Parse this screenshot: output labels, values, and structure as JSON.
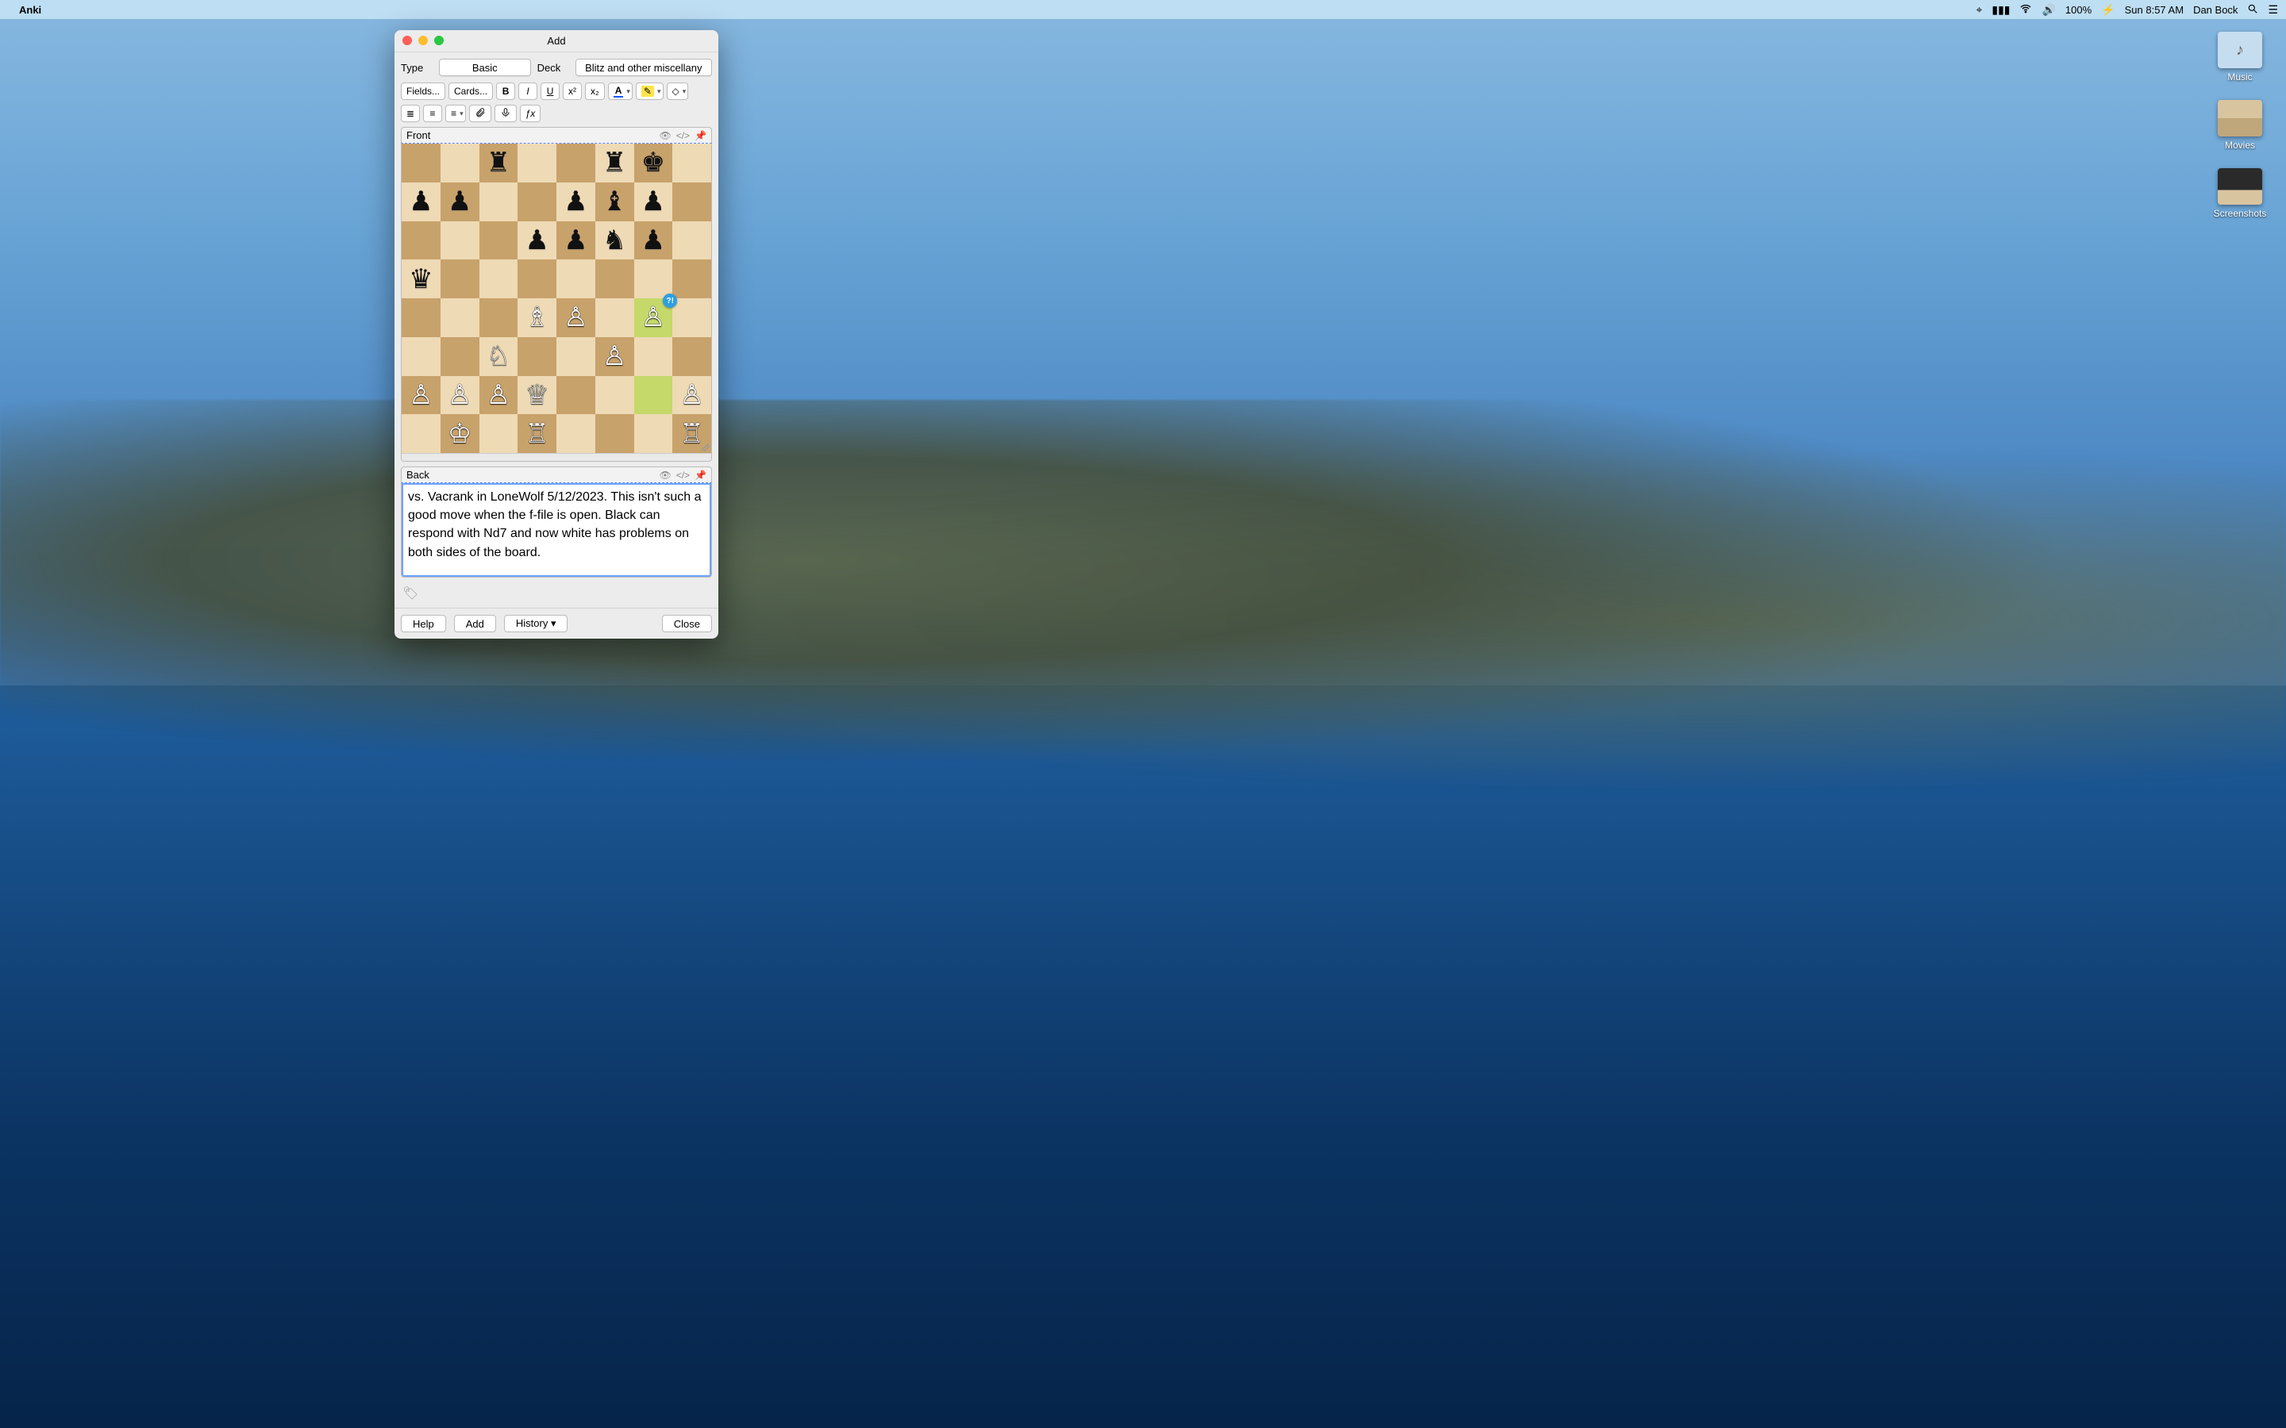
{
  "menubar": {
    "app_name": "Anki",
    "battery": "100%",
    "clock": "Sun 8:57 AM",
    "user": "Dan Bock"
  },
  "desktop": {
    "icons": [
      {
        "label": "Music"
      },
      {
        "label": "Movies"
      },
      {
        "label": "Screenshots"
      }
    ]
  },
  "window": {
    "title": "Add",
    "type_label": "Type",
    "type_value": "Basic",
    "deck_label": "Deck",
    "deck_value": "Blitz and other miscellany",
    "toolbar": {
      "fields": "Fields...",
      "cards": "Cards...",
      "bold": "B",
      "italic": "I",
      "underline": "U",
      "super": "x²",
      "sub": "x₂",
      "text_color": "A",
      "highlight": "✎",
      "eraser": "⌫",
      "ul": "•",
      "ol": "1.",
      "align": "≡",
      "attach": "📎",
      "mic": "🎤",
      "fx": "ƒx"
    },
    "fields": {
      "front_label": "Front",
      "back_label": "Back",
      "back_text": "vs. Vacrank in LoneWolf 5/12/2023. This isn't such a good move when the f-file is open. Black can respond with Nd7 and now white has problems on both sides of the board."
    },
    "chess": {
      "highlight_squares": [
        "g4",
        "g2"
      ],
      "annotation": {
        "square": "g4",
        "text": "?!"
      },
      "pieces": [
        {
          "sq": "c8",
          "p": "♜",
          "c": "b"
        },
        {
          "sq": "f8",
          "p": "♜",
          "c": "b"
        },
        {
          "sq": "g8",
          "p": "♚",
          "c": "b"
        },
        {
          "sq": "a7",
          "p": "♟",
          "c": "b"
        },
        {
          "sq": "b7",
          "p": "♟",
          "c": "b"
        },
        {
          "sq": "e7",
          "p": "♟",
          "c": "b"
        },
        {
          "sq": "f7",
          "p": "♝",
          "c": "b"
        },
        {
          "sq": "g7",
          "p": "♟",
          "c": "b"
        },
        {
          "sq": "d6",
          "p": "♟",
          "c": "b"
        },
        {
          "sq": "e6",
          "p": "♟",
          "c": "b"
        },
        {
          "sq": "f6",
          "p": "♞",
          "c": "b"
        },
        {
          "sq": "g6",
          "p": "♟",
          "c": "b"
        },
        {
          "sq": "a5",
          "p": "♛",
          "c": "b"
        },
        {
          "sq": "d4",
          "p": "♗",
          "c": "w"
        },
        {
          "sq": "e4",
          "p": "♙",
          "c": "w"
        },
        {
          "sq": "g4",
          "p": "♙",
          "c": "w"
        },
        {
          "sq": "c3",
          "p": "♘",
          "c": "w"
        },
        {
          "sq": "f3",
          "p": "♙",
          "c": "w"
        },
        {
          "sq": "a2",
          "p": "♙",
          "c": "w"
        },
        {
          "sq": "b2",
          "p": "♙",
          "c": "w"
        },
        {
          "sq": "c2",
          "p": "♙",
          "c": "w"
        },
        {
          "sq": "d2",
          "p": "♕",
          "c": "w"
        },
        {
          "sq": "h2",
          "p": "♙",
          "c": "w"
        },
        {
          "sq": "b1",
          "p": "♔",
          "c": "w"
        },
        {
          "sq": "d1",
          "p": "♖",
          "c": "w"
        },
        {
          "sq": "h1",
          "p": "♖",
          "c": "w"
        }
      ]
    },
    "footer": {
      "help": "Help",
      "add": "Add",
      "history": "History ▾",
      "close": "Close"
    }
  }
}
